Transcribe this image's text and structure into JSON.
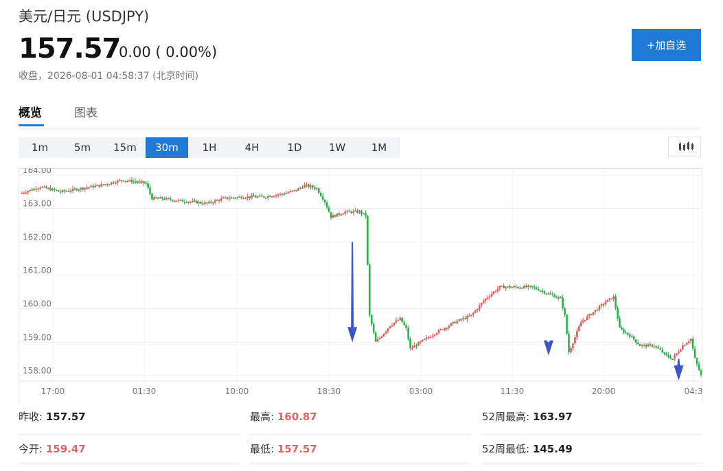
{
  "header": {
    "title": "美元/日元 (USDJPY)",
    "price": "157.57",
    "change": "0.00 ( 0.00%)",
    "status": "收盘，2026-08-01 04:58:37 (北京时间)",
    "add_label": "+加自选"
  },
  "tabs": [
    {
      "label": "概览",
      "active": true
    },
    {
      "label": "图表",
      "active": false
    }
  ],
  "intervals": [
    {
      "label": "1m"
    },
    {
      "label": "5m"
    },
    {
      "label": "15m"
    },
    {
      "label": "30m",
      "active": true
    },
    {
      "label": "1H"
    },
    {
      "label": "4H"
    },
    {
      "label": "1D"
    },
    {
      "label": "1W"
    },
    {
      "label": "1M"
    }
  ],
  "icons": {
    "chart_type": "candlestick-icon"
  },
  "colors": {
    "up": "#e35b5b",
    "down": "#27b34a",
    "accent": "#1f7ad6",
    "arrow": "#3a56c8"
  },
  "chart_data": {
    "type": "candlestick",
    "title": "",
    "xlabel": "",
    "ylabel": "",
    "ylim": [
      157.85,
      164.3
    ],
    "yticks": [
      "164.00",
      "163.00",
      "162.00",
      "161.00",
      "160.00",
      "159.00",
      "158.00"
    ],
    "xticks": [
      "17:00",
      "01:30",
      "10:00",
      "18:30",
      "03:00",
      "11:30",
      "20:00",
      "04:3"
    ],
    "grid": true,
    "anchors": [
      [
        0,
        163.45
      ],
      [
        10,
        163.65
      ],
      [
        20,
        163.5
      ],
      [
        30,
        163.6
      ],
      [
        40,
        163.7
      ],
      [
        50,
        163.85
      ],
      [
        58,
        163.8
      ],
      [
        62,
        163.75
      ],
      [
        65,
        163.3
      ],
      [
        70,
        163.3
      ],
      [
        76,
        163.25
      ],
      [
        85,
        163.2
      ],
      [
        92,
        163.15
      ],
      [
        100,
        163.3
      ],
      [
        110,
        163.35
      ],
      [
        120,
        163.35
      ],
      [
        130,
        163.45
      ],
      [
        136,
        163.55
      ],
      [
        140,
        163.7
      ],
      [
        146,
        163.6
      ],
      [
        150,
        163.2
      ],
      [
        153,
        162.75
      ],
      [
        160,
        162.9
      ],
      [
        167,
        162.9
      ],
      [
        170,
        162.8
      ],
      [
        172,
        159.8
      ],
      [
        175,
        159.0
      ],
      [
        178,
        159.2
      ],
      [
        182,
        159.5
      ],
      [
        187,
        159.7
      ],
      [
        190,
        159.4
      ],
      [
        192,
        158.8
      ],
      [
        197,
        159.0
      ],
      [
        205,
        159.3
      ],
      [
        214,
        159.6
      ],
      [
        222,
        159.8
      ],
      [
        229,
        160.3
      ],
      [
        236,
        160.65
      ],
      [
        244,
        160.65
      ],
      [
        252,
        160.65
      ],
      [
        258,
        160.5
      ],
      [
        266,
        160.3
      ],
      [
        268,
        159.8
      ],
      [
        270,
        158.7
      ],
      [
        272,
        159.0
      ],
      [
        276,
        159.6
      ],
      [
        288,
        160.2
      ],
      [
        292,
        160.35
      ],
      [
        295,
        159.4
      ],
      [
        300,
        159.2
      ],
      [
        305,
        158.9
      ],
      [
        312,
        158.9
      ],
      [
        318,
        158.6
      ],
      [
        321,
        158.5
      ],
      [
        326,
        158.9
      ],
      [
        330,
        159.1
      ],
      [
        332,
        158.5
      ],
      [
        335,
        158.0
      ]
    ],
    "arrows": [
      {
        "x": 163.5,
        "from": 162.0,
        "to": 159.0
      },
      {
        "x": 260,
        "from": 159.0,
        "to": 158.6
      },
      {
        "x": 324,
        "from": 158.5,
        "to": 157.85
      }
    ]
  },
  "stats": [
    {
      "label": "昨收:",
      "value": "157.57",
      "tone": "neutral"
    },
    {
      "label": "最高:",
      "value": "160.87",
      "tone": "up"
    },
    {
      "label": "52周最高:",
      "value": "163.97",
      "tone": "neutral"
    },
    {
      "label": "今开:",
      "value": "159.47",
      "tone": "up"
    },
    {
      "label": "最低:",
      "value": "157.57",
      "tone": "up"
    },
    {
      "label": "52周最低:",
      "value": "145.49",
      "tone": "neutral"
    }
  ]
}
